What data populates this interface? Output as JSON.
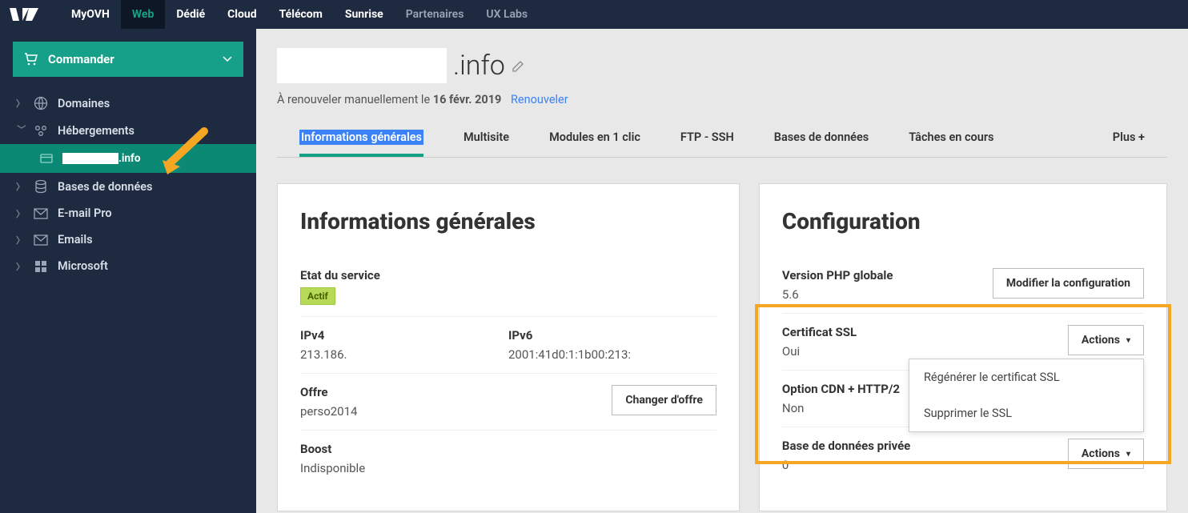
{
  "topnav": {
    "items": [
      "MyOVH",
      "Web",
      "Dédié",
      "Cloud",
      "Télécom",
      "Sunrise",
      "Partenaires",
      "UX Labs"
    ],
    "active_index": 1
  },
  "sidebar": {
    "order_label": "Commander",
    "items": [
      {
        "label": "Domaines",
        "icon": "globe",
        "expanded": false
      },
      {
        "label": "Hébergements",
        "icon": "server",
        "expanded": true,
        "children": [
          {
            "label": ".info"
          }
        ]
      },
      {
        "label": "Bases de données",
        "icon": "database",
        "expanded": false
      },
      {
        "label": "E-mail Pro",
        "icon": "mail",
        "expanded": false
      },
      {
        "label": "Emails",
        "icon": "mail",
        "expanded": false
      },
      {
        "label": "Microsoft",
        "icon": "windows",
        "expanded": false
      }
    ]
  },
  "page": {
    "title_suffix": ".info",
    "renew_prefix": "À renouveler manuellement le ",
    "renew_date": "16 févr. 2019",
    "renew_link": "Renouveler"
  },
  "tabs": {
    "items": [
      "Informations générales",
      "Multisite",
      "Modules en 1 clic",
      "FTP - SSH",
      "Bases de données",
      "Tâches en cours",
      "Plus +"
    ],
    "active_index": 0
  },
  "info_panel": {
    "heading": "Informations générales",
    "state_label": "Etat du service",
    "state_value": "Actif",
    "ipv4_label": "IPv4",
    "ipv4_value": "213.186.",
    "ipv6_label": "IPv6",
    "ipv6_value": "2001:41d0:1:1b00:213:",
    "offer_label": "Offre",
    "offer_value": "perso2014",
    "offer_button": "Changer d'offre",
    "boost_label": "Boost",
    "boost_value": "Indisponible"
  },
  "config_panel": {
    "heading": "Configuration",
    "php_label": "Version PHP globale",
    "php_value": "5.6",
    "php_button": "Modifier la configuration",
    "ssl_label": "Certificat SSL",
    "ssl_value": "Oui",
    "ssl_button": "Actions",
    "cdn_label": "Option CDN + HTTP/2",
    "cdn_value": "Non",
    "dbpriv_label": "Base de données privée",
    "dbpriv_value": "0",
    "dbpriv_button": "Actions"
  },
  "ssl_menu": {
    "regen": "Régénérer le certificat SSL",
    "delete": "Supprimer le SSL"
  }
}
